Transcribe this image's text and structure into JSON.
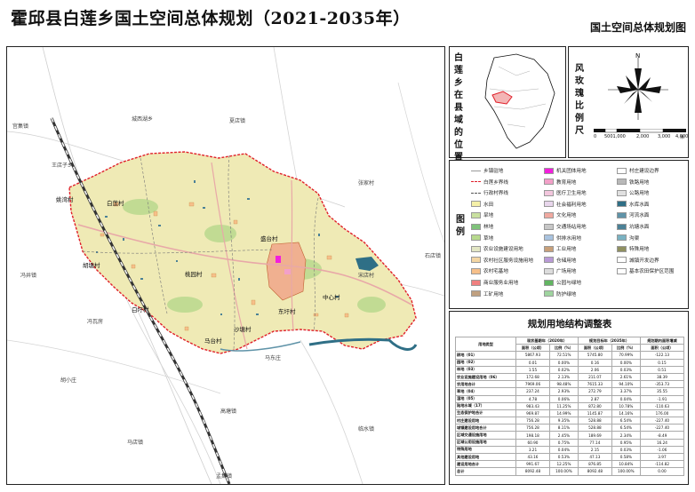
{
  "header": {
    "title": "霍邱县白莲乡国土空间总体规划（2021-2035年）",
    "subtitle": "国土空间总体规划图"
  },
  "colors": {
    "boundary": "#e0202a",
    "township_fill": "#efeab5",
    "water": "#2f6f86",
    "road": "#e8a8a8",
    "railway": "#333333"
  },
  "map": {
    "place_labels": [
      "宫集镇",
      "城西湖乡",
      "夏店镇",
      "张家村",
      "石店镇",
      "王店子乡",
      "宋店村",
      "冯井镇",
      "冯瓦房",
      "胡小庄",
      "马东庄",
      "马店镇",
      "高塘镇",
      "临水镇",
      "孟集镇"
    ],
    "villages": [
      "白莲村",
      "姚湾村",
      "盛台村",
      "桃园村",
      "胡塘村",
      "中心村",
      "东圩村",
      "马台村",
      "白圩村",
      "沙塘村"
    ]
  },
  "location_panel": {
    "title": "白莲乡在县域的位置"
  },
  "scale_panel": {
    "title": "风玫瑰比例尺",
    "north": "N",
    "scale_labels": [
      "0",
      "5001,000",
      "2,000",
      "3,000",
      "4,000"
    ],
    "unit": "米"
  },
  "legend": {
    "title": "图例",
    "items": [
      {
        "label": "乡镇驻地",
        "color": "#ffffff",
        "style": "line"
      },
      {
        "label": "白莲乡界线",
        "color": "#e0202a",
        "style": "dash"
      },
      {
        "label": "行政村界线",
        "color": "#555555",
        "style": "dash"
      },
      {
        "label": "水田",
        "color": "#f5f0a8"
      },
      {
        "label": "旱地",
        "color": "#c9e0a0"
      },
      {
        "label": "林地",
        "color": "#7fc27a"
      },
      {
        "label": "草地",
        "color": "#b7d98d"
      },
      {
        "label": "农业设施建设用地",
        "color": "#e2e6c4"
      },
      {
        "label": "农村社区服务设施用地",
        "color": "#f3d6a3"
      },
      {
        "label": "农村宅基地",
        "color": "#f6c08a"
      },
      {
        "label": "商业服务业用地",
        "color": "#f08080"
      },
      {
        "label": "工矿用地",
        "color": "#c0a080"
      },
      {
        "label": "机关团体用地",
        "color": "#f21fdc"
      },
      {
        "label": "教育用地",
        "color": "#f2a0c8"
      },
      {
        "label": "医疗卫生用地",
        "color": "#f2c6dd"
      },
      {
        "label": "社会福利用地",
        "color": "#e8d6ec"
      },
      {
        "label": "文化用地",
        "color": "#f0a9a0"
      },
      {
        "label": "交通场站用地",
        "color": "#c7c7c7"
      },
      {
        "label": "供排水用地",
        "color": "#a9c3df"
      },
      {
        "label": "工业用地",
        "color": "#c8a07a"
      },
      {
        "label": "仓储用地",
        "color": "#b99ad6"
      },
      {
        "label": "广场用地",
        "color": "#dcdcdc"
      },
      {
        "label": "公园与绿地",
        "color": "#62b562"
      },
      {
        "label": "防护绿地",
        "color": "#9fd49f"
      },
      {
        "label": "村庄建设边界",
        "color": "#ffffff"
      },
      {
        "label": "铁路用地",
        "color": "#b8b8b8"
      },
      {
        "label": "公路用地",
        "color": "#e0e0e0"
      },
      {
        "label": "水库水面",
        "color": "#2f6f86"
      },
      {
        "label": "河流水面",
        "color": "#5f93a8"
      },
      {
        "label": "坑塘水面",
        "color": "#4b8196"
      },
      {
        "label": "沟渠",
        "color": "#7ab2c2"
      },
      {
        "label": "特殊用地",
        "color": "#909060"
      },
      {
        "label": "城镇开发边界",
        "color": "#ffffff"
      },
      {
        "label": "基本农田保护区范围",
        "color": "#ffffff"
      }
    ]
  },
  "table": {
    "title": "规划用地结构调整表",
    "headers": [
      "用地类型",
      "现状基期年（2020年）",
      "",
      "规划目标年（2035年）",
      "",
      "规划期内面积增减"
    ],
    "subheaders": [
      "",
      "面积（公顷）",
      "比例（%）",
      "面积（公顷）",
      "比例（%）",
      "面积（公顷）"
    ],
    "rows": [
      [
        "耕地（01）",
        "5867.93",
        "72.51%",
        "5745.80",
        "70.99%",
        "-122.13"
      ],
      [
        "园地（02）",
        "0.01",
        "0.00%",
        "0.16",
        "0.00%",
        "0.15"
      ],
      [
        "林地（03）",
        "1.55",
        "0.02%",
        "2.06",
        "0.03%",
        "0.51"
      ],
      [
        "农业设施建设用地（06）",
        "172.68",
        "2.13%",
        "211.07",
        "2.61%",
        "38.39"
      ],
      [
        "农用地合计",
        "7969.06",
        "98.48%",
        "7615.33",
        "94.10%",
        "-353.73"
      ],
      [
        "草地（04）",
        "237.24",
        "2.93%",
        "272.79",
        "3.37%",
        "35.55"
      ],
      [
        "湿地（05）",
        "4.78",
        "0.06%",
        "2.87",
        "0.04%",
        "-1.91"
      ],
      [
        "陆地水域（17）",
        "983.43",
        "11.25%",
        "872.80",
        "10.78%",
        "-110.63"
      ],
      [
        "生态保护地合计",
        "969.87",
        "14.99%",
        "1145.87",
        "14.16%",
        "176.00"
      ],
      [
        "村庄建设用地",
        "756.28",
        "9.35%",
        "528.88",
        "6.54%",
        "-227.40"
      ],
      [
        "城镇建设用地合计",
        "756.28",
        "8.11%",
        "528.88",
        "6.54%",
        "-227.40"
      ],
      [
        "区域交通设施用地",
        "198.18",
        "2.45%",
        "189.69",
        "2.34%",
        "-8.49"
      ],
      [
        "区域公用设施用地",
        "60.90",
        "0.75%",
        "77.14",
        "0.95%",
        "16.24"
      ],
      [
        "特殊用地",
        "3.21",
        "0.04%",
        "2.15",
        "0.03%",
        "-1.06"
      ],
      [
        "其他建设用地",
        "43.16",
        "0.53%",
        "47.13",
        "0.58%",
        "3.97"
      ],
      [
        "建设用地合计",
        "991.67",
        "12.25%",
        "876.85",
        "10.84%",
        "-114.82"
      ],
      [
        "总计",
        "8092.48",
        "100.00%",
        "8092.48",
        "100.00%",
        "0.00"
      ]
    ]
  }
}
